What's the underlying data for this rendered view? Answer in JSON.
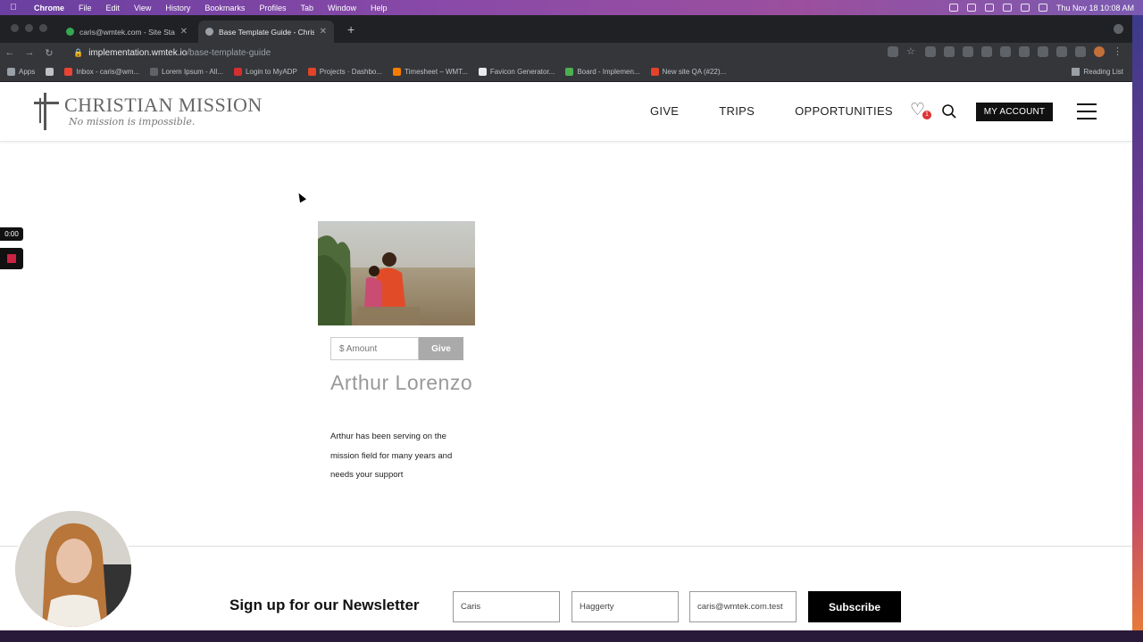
{
  "menubar": {
    "items": [
      "Chrome",
      "File",
      "Edit",
      "View",
      "History",
      "Bookmarks",
      "Profiles",
      "Tab",
      "Window",
      "Help"
    ],
    "clock": "Thu Nov 18  10:08 AM"
  },
  "browser": {
    "tabs": [
      {
        "title": "caris@wmtek.com - Site Stack",
        "active": false
      },
      {
        "title": "Base Template Guide - Christia",
        "active": true
      }
    ],
    "url_host": "implementation.wmtek.io",
    "url_path": "/base-template-guide",
    "bookmarks": [
      {
        "label": "Apps",
        "color": "#9aa0a6"
      },
      {
        "label": "",
        "color": "#bdc1c6"
      },
      {
        "label": "Inbox - caris@wm...",
        "color": "#ea4335"
      },
      {
        "label": "Lorem Ipsum - All...",
        "color": "#5f6368"
      },
      {
        "label": "Login to MyADP",
        "color": "#d32f2f"
      },
      {
        "label": "Projects · Dashbo...",
        "color": "#e24329"
      },
      {
        "label": "Timesheet – WMT...",
        "color": "#f57c00"
      },
      {
        "label": "Favicon Generator...",
        "color": "#e8eaed"
      },
      {
        "label": "Board - Implemen...",
        "color": "#4caf50"
      },
      {
        "label": "New site QA (#22)...",
        "color": "#e24329"
      }
    ],
    "reading_list": "Reading List"
  },
  "site": {
    "logo_name": "CHRISTIAN MISSION",
    "logo_tagline": "No mission is impossible.",
    "nav": [
      "GIVE",
      "TRIPS",
      "OPPORTUNITIES"
    ],
    "cart_count": "1",
    "account_label": "MY ACCOUNT"
  },
  "card": {
    "amount_placeholder": "$ Amount",
    "give_label": "Give",
    "name": "Arthur Lorenzo",
    "description": "Arthur has been serving on the mission field for many years and needs your support"
  },
  "newsletter": {
    "title": "Sign up for our Newsletter",
    "first_name": "Caris",
    "last_name": "Haggerty",
    "email": "caris@wmtek.com.test",
    "subscribe_label": "Subscribe"
  },
  "recorder": {
    "time": "0:00"
  }
}
